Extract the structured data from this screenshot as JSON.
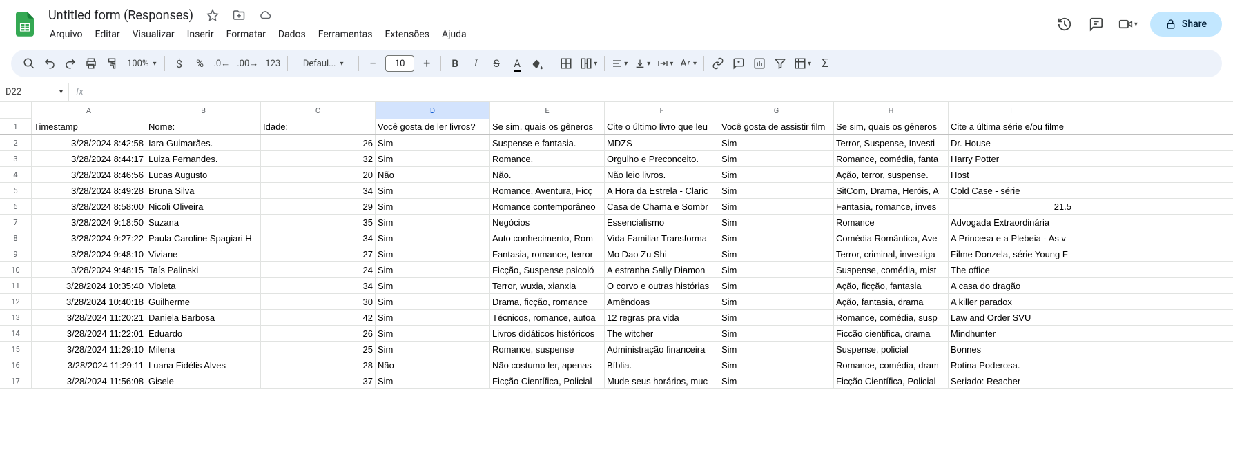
{
  "doc": {
    "title": "Untitled form (Responses)"
  },
  "menus": [
    "Arquivo",
    "Editar",
    "Visualizar",
    "Inserir",
    "Formatar",
    "Dados",
    "Ferramentas",
    "Extensões",
    "Ajuda"
  ],
  "share": "Share",
  "toolbar": {
    "zoom": "100%",
    "font": "Defaul...",
    "fontSize": "10",
    "numfmt": "123"
  },
  "nameBox": "D22",
  "cols": [
    "A",
    "B",
    "C",
    "D",
    "E",
    "F",
    "G",
    "H",
    "I"
  ],
  "headers": {
    "A": "Timestamp",
    "B": "Nome:",
    "C": "Idade:",
    "D": "Você gosta de ler livros?",
    "E": "Se sim, quais os gêneros",
    "F": "Cite o último livro que leu",
    "G": "Você gosta de assistir film",
    "H": "Se sim, quais os gêneros",
    "I": "Cite a última série e/ou filme"
  },
  "rows": [
    {
      "n": "2",
      "A": "3/28/2024 8:42:58",
      "B": "Iara Guimarães.",
      "C": "26",
      "D": "Sim",
      "E": "Suspense e fantasia.",
      "F": "MDZS",
      "G": "Sim",
      "H": "Terror, Suspense, Investi",
      "I": "Dr. House"
    },
    {
      "n": "3",
      "A": "3/28/2024 8:44:17",
      "B": "Luiza Fernandes.",
      "C": "32",
      "D": "Sim",
      "E": "Romance.",
      "F": "Orgulho e Preconceito.",
      "G": "Sim",
      "H": "Romance, comédia, fanta",
      "I": "Harry Potter"
    },
    {
      "n": "4",
      "A": "3/28/2024 8:46:56",
      "B": "Lucas Augusto",
      "C": "20",
      "D": "Não",
      "E": "Não.",
      "F": "Não leio livros.",
      "G": "Sim",
      "H": "Ação, terror, suspense.",
      "I": "Host"
    },
    {
      "n": "5",
      "A": "3/28/2024 8:49:28",
      "B": "Bruna Silva",
      "C": "34",
      "D": "Sim",
      "E": "Romance, Aventura, Ficç",
      "F": "A Hora da Estrela - Claric",
      "G": "Sim",
      "H": "SitCom, Drama, Heróis, A",
      "I": "Cold Case - série"
    },
    {
      "n": "6",
      "A": "3/28/2024 8:58:00",
      "B": "Nicoli Oliveira",
      "C": "29",
      "D": "Sim",
      "E": "Romance contemporâneo",
      "F": "Casa de Chama e Sombr",
      "G": "Sim",
      "H": "Fantasia, romance, inves",
      "I": "21.5",
      "Inum": true
    },
    {
      "n": "7",
      "A": "3/28/2024 9:18:50",
      "B": "Suzana",
      "C": "35",
      "D": "Sim",
      "E": "Negócios",
      "F": "Essencialismo",
      "G": "Sim",
      "H": "Romance",
      "I": "Advogada Extraordinária"
    },
    {
      "n": "8",
      "A": "3/28/2024 9:27:22",
      "B": "Paula Caroline Spagiari H",
      "C": "34",
      "D": "Sim",
      "E": "Auto conhecimento, Rom",
      "F": "Vida Familiar Transforma",
      "G": "Sim",
      "H": "Comédia Romântica, Ave",
      "I": "A Princesa e a Plebeia - As v"
    },
    {
      "n": "9",
      "A": "3/28/2024 9:48:10",
      "B": "Viviane",
      "C": "27",
      "D": "Sim",
      "E": "Fantasia, romance, terror",
      "F": "Mo Dao Zu Shi",
      "G": "Sim",
      "H": "Terror, criminal, investiga",
      "I": "Filme Donzela, série Young F"
    },
    {
      "n": "10",
      "A": "3/28/2024 9:48:15",
      "B": "Taís Palinski",
      "C": "24",
      "D": "Sim",
      "E": "Ficção, Suspense psicoló",
      "F": "A estranha Sally Diamon",
      "G": "Sim",
      "H": "Suspense, comédia, mist",
      "I": "The office"
    },
    {
      "n": "11",
      "A": "3/28/2024 10:35:40",
      "B": "Violeta",
      "C": "34",
      "D": "Sim",
      "E": "Terror, wuxia, xianxia",
      "F": "O corvo e outras histórias",
      "G": "Sim",
      "H": "Ação, ficção, fantasia",
      "I": "A casa do dragão"
    },
    {
      "n": "12",
      "A": "3/28/2024 10:40:18",
      "B": "Guilherme",
      "C": "30",
      "D": "Sim",
      "E": "Drama, ficção, romance",
      "F": "Amêndoas",
      "G": "Sim",
      "H": "Ação, fantasia, drama",
      "I": "A killer paradox"
    },
    {
      "n": "13",
      "A": "3/28/2024 11:20:21",
      "B": "Daniela Barbosa",
      "C": "42",
      "D": "Sim",
      "E": "Técnicos, romance, autoa",
      "F": "12 regras pra vida",
      "G": "Sim",
      "H": "Romance, comédia, susp",
      "I": "Law and Order SVU"
    },
    {
      "n": "14",
      "A": "3/28/2024 11:22:01",
      "B": "Eduardo",
      "C": "26",
      "D": "Sim",
      "E": "Livros didáticos históricos",
      "F": "The witcher",
      "G": "Sim",
      "H": "Ficcão cientifica, drama",
      "I": "Mindhunter"
    },
    {
      "n": "15",
      "A": "3/28/2024 11:29:10",
      "B": "Milena",
      "C": "25",
      "D": "Sim",
      "E": "Romance, suspense",
      "F": "Administração financeira",
      "G": "Sim",
      "H": "Suspense, policial",
      "I": "Bonnes"
    },
    {
      "n": "16",
      "A": "3/28/2024 11:29:11",
      "B": "Luana Fidélis Alves",
      "C": "28",
      "D": "Não",
      "E": "Não costumo ler, apenas",
      "F": "Bíblia.",
      "G": "Sim",
      "H": "Romance, comédia, dram",
      "I": "Rotina Poderosa."
    },
    {
      "n": "17",
      "A": "3/28/2024 11:56:08",
      "B": "Gisele",
      "C": "37",
      "D": "Sim",
      "E": "Ficção Científica, Policial",
      "F": "Mude seus horários, muc",
      "G": "Sim",
      "H": "Ficção Científica, Policial",
      "I": "Seriado: Reacher"
    }
  ]
}
